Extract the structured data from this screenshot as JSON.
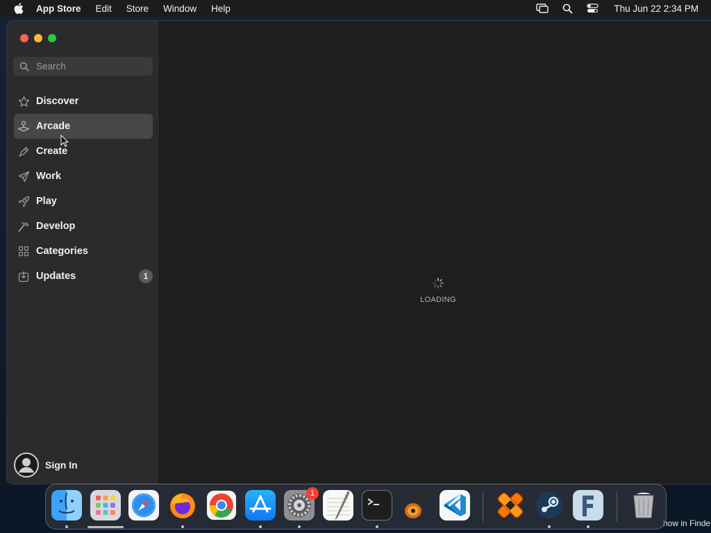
{
  "menubar": {
    "app_name": "App Store",
    "items": [
      "Edit",
      "Store",
      "Window",
      "Help"
    ],
    "clock": "Thu Jun 22  2:34 PM",
    "status_icons": [
      "screen-mirroring-icon",
      "spotlight-search-icon",
      "control-center-icon"
    ]
  },
  "window": {
    "search": {
      "placeholder": "Search",
      "value": ""
    },
    "nav": [
      {
        "label": "Discover",
        "icon": "star-icon",
        "active": false
      },
      {
        "label": "Arcade",
        "icon": "joystick-icon",
        "active": true
      },
      {
        "label": "Create",
        "icon": "brush-icon",
        "active": false
      },
      {
        "label": "Work",
        "icon": "paper-plane-icon",
        "active": false
      },
      {
        "label": "Play",
        "icon": "rocket-icon",
        "active": false
      },
      {
        "label": "Develop",
        "icon": "hammer-icon",
        "active": false
      },
      {
        "label": "Categories",
        "icon": "grid-icon",
        "active": false
      },
      {
        "label": "Updates",
        "icon": "download-tray-icon",
        "active": false,
        "badge": "1"
      }
    ],
    "sign_in_label": "Sign In",
    "main": {
      "loading_label": "LOADING"
    }
  },
  "dock": {
    "apps": [
      "finder",
      "launchpad",
      "safari",
      "firefox",
      "chrome",
      "app-store",
      "system-settings",
      "textedit",
      "terminal",
      "garageband",
      "vscode",
      "crossover",
      "steam",
      "fontforge",
      "trash"
    ],
    "system_settings_badge": "1"
  },
  "finder_tip": "how in Finde",
  "colors": {
    "sidebar_bg": "#2b2b2d",
    "active_item_bg": "#47474a",
    "main_bg": "#1e1e1e",
    "close": "#ff5f57",
    "minimize": "#febc2e",
    "zoom": "#28c840",
    "badge_red": "#ff3b30"
  }
}
